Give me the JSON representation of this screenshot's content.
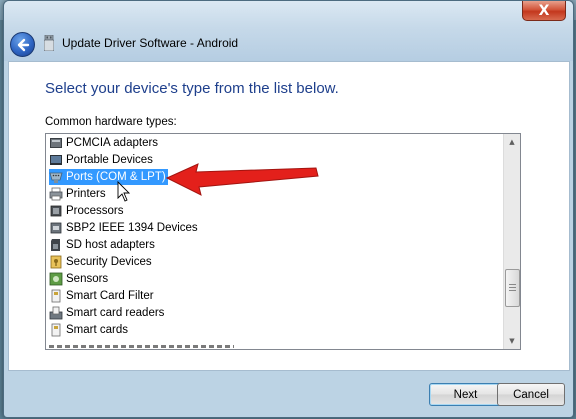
{
  "window": {
    "title": "Update Driver Software - Android",
    "close_glyph": "X",
    "back_icon": "back-arrow-icon"
  },
  "main": {
    "heading": "Select your device's type from the list below.",
    "list_label": "Common hardware types:",
    "items": [
      {
        "label": "PCMCIA adapters",
        "icon": "pcmcia-icon",
        "selected": false
      },
      {
        "label": "Portable Devices",
        "icon": "portable-device-icon",
        "selected": false
      },
      {
        "label": "Ports (COM & LPT)",
        "icon": "port-icon",
        "selected": true
      },
      {
        "label": "Printers",
        "icon": "printer-icon",
        "selected": false
      },
      {
        "label": "Processors",
        "icon": "processor-icon",
        "selected": false
      },
      {
        "label": "SBP2 IEEE 1394 Devices",
        "icon": "firewire-icon",
        "selected": false
      },
      {
        "label": "SD host adapters",
        "icon": "sd-card-icon",
        "selected": false
      },
      {
        "label": "Security Devices",
        "icon": "security-device-icon",
        "selected": false
      },
      {
        "label": "Sensors",
        "icon": "sensor-icon",
        "selected": false
      },
      {
        "label": "Smart Card Filter",
        "icon": "smart-card-icon",
        "selected": false
      },
      {
        "label": "Smart card readers",
        "icon": "card-reader-icon",
        "selected": false
      },
      {
        "label": "Smart cards",
        "icon": "smart-card-icon",
        "selected": false
      }
    ]
  },
  "footer": {
    "next_label": "Next",
    "cancel_label": "Cancel"
  },
  "colors": {
    "heading": "#1e3f8c",
    "selection": "#3399ff",
    "annotation_arrow": "#e3201b"
  }
}
